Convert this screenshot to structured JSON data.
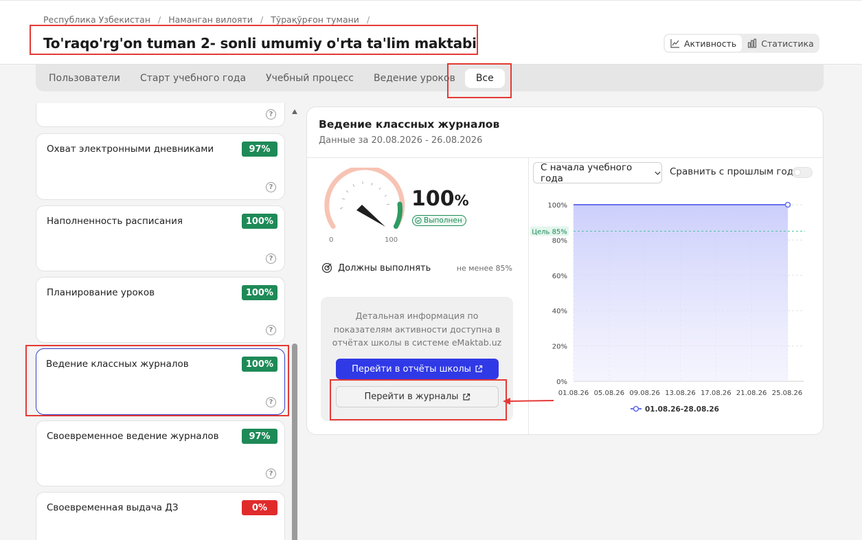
{
  "breadcrumb": [
    "Республика Узбекистан",
    "Наманган вилояти",
    "Тўрақўрғон тумани"
  ],
  "page_title": "To'raqo'rg'on tuman 2- sonli umumiy o'rta ta'lim maktabi",
  "view_toggle": {
    "activity": "Активность",
    "statistics": "Статистика"
  },
  "tabs": [
    "Пользователи",
    "Старт учебного года",
    "Учебный процесс",
    "Ведение уроков",
    "Все"
  ],
  "active_tab": "Все",
  "metrics": [
    {
      "label": "",
      "value": ""
    },
    {
      "label": "Охват электронными дневниками",
      "value": "97%",
      "status": "green"
    },
    {
      "label": "Наполненность расписания",
      "value": "100%",
      "status": "green"
    },
    {
      "label": "Планирование уроков",
      "value": "100%",
      "status": "green"
    },
    {
      "label": "Ведение классных журналов",
      "value": "100%",
      "status": "green",
      "selected": true
    },
    {
      "label": "Своевременное ведение журналов",
      "value": "97%",
      "status": "green"
    },
    {
      "label": "Своевременная выдача ДЗ",
      "value": "0%",
      "status": "red"
    }
  ],
  "panel": {
    "title": "Ведение классных журналов",
    "subtitle": "Данные за 20.08.2026 - 26.08.2026",
    "gauge_value": 100,
    "gauge_min": "0",
    "gauge_max": "100",
    "big_value": "100",
    "big_unit": "%",
    "status": "Выполнен",
    "should_label": "Должны выполнять",
    "min_note": "не менее 85%",
    "info_text": "Детальная информация по показателям активности доступна в отчётах школы в системе eMaktab.uz",
    "btn_reports": "Перейти в отчёты школы",
    "btn_journals": "Перейти в журналы",
    "period_select": "С начала учебного года",
    "compare_label": "Сравнить с прошлым годом",
    "compare_enabled": false
  },
  "colors": {
    "accent": "#3039e6",
    "success": "#1e8a57",
    "danger": "#e02b2b",
    "annotation": "#e53935"
  },
  "chart_data": {
    "type": "area",
    "x": [
      "01.08.26",
      "05.08.26",
      "09.08.26",
      "13.08.26",
      "17.08.26",
      "21.08.26",
      "25.08.26"
    ],
    "ylim": [
      0,
      100
    ],
    "yticks": [
      "0%",
      "20%",
      "40%",
      "60%",
      "80%",
      "100%"
    ],
    "series": [
      {
        "name": "01.08.26-28.08.26",
        "values": [
          100,
          100,
          100,
          100,
          100,
          100,
          100
        ]
      }
    ],
    "goal": {
      "label": "Цель 85%",
      "value": 85
    },
    "grid": true,
    "legend": "bottom"
  }
}
